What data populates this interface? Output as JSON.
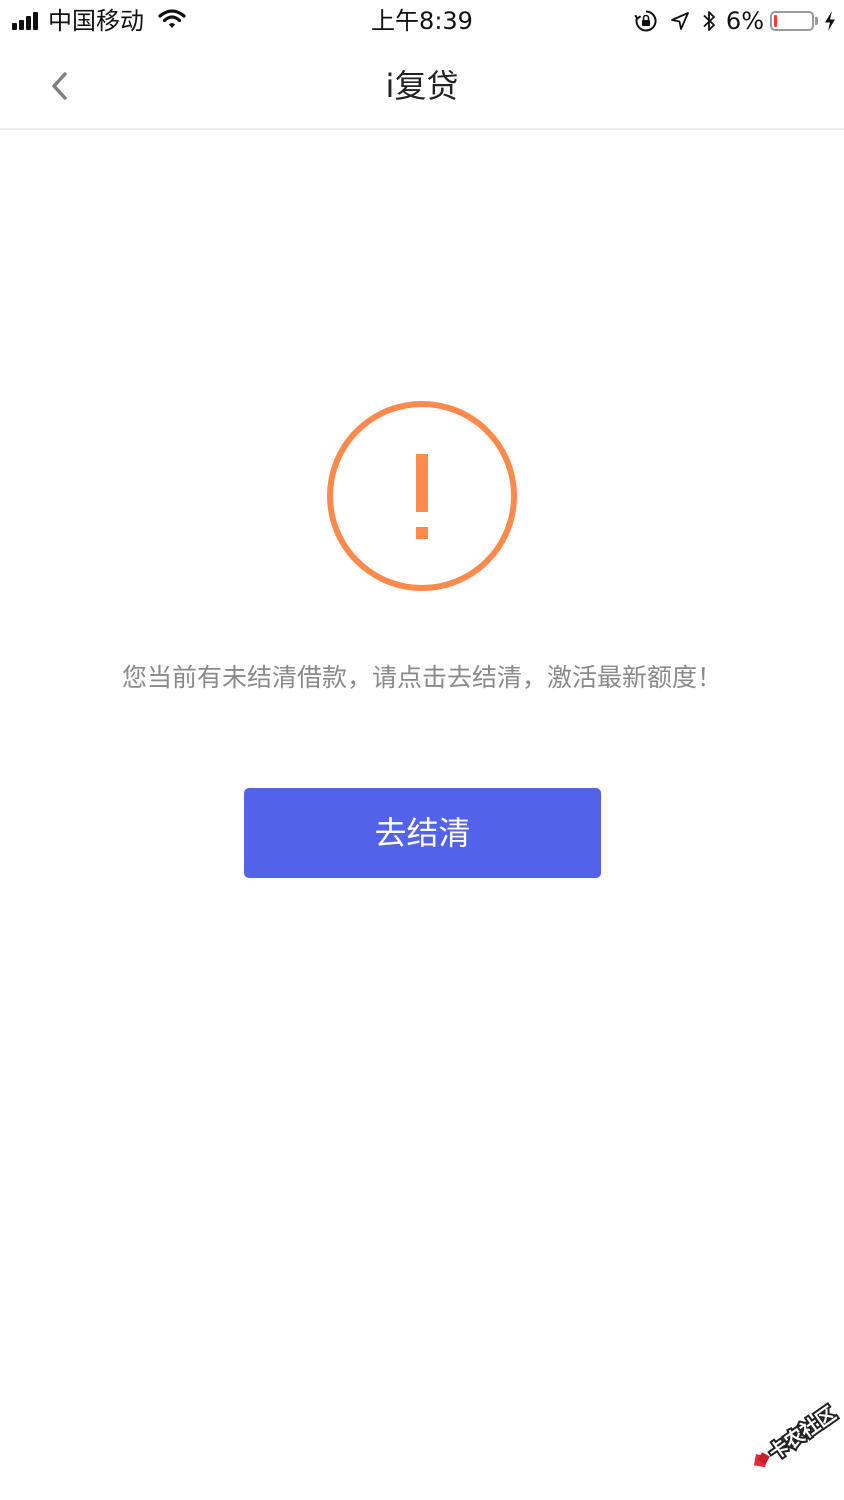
{
  "status_bar": {
    "carrier": "中国移动",
    "time": "上午8:39",
    "battery_percent": "6%",
    "battery_level": 0.06,
    "icons": [
      "signal-icon",
      "wifi-icon",
      "orientation-lock-icon",
      "location-icon",
      "bluetooth-icon",
      "battery-icon",
      "charging-icon"
    ]
  },
  "nav": {
    "title": "i复贷",
    "back_icon": "chevron-left-icon"
  },
  "main": {
    "icon": "exclamation-circle-icon",
    "message": "您当前有未结清借款，请点击去结清，激活最新额度！",
    "button_label": "去结清"
  },
  "watermark": {
    "text": "卡农社区"
  },
  "colors": {
    "accent": "#5363e9",
    "warning": "#ff8a4c",
    "message_text": "#8a8a8a"
  }
}
